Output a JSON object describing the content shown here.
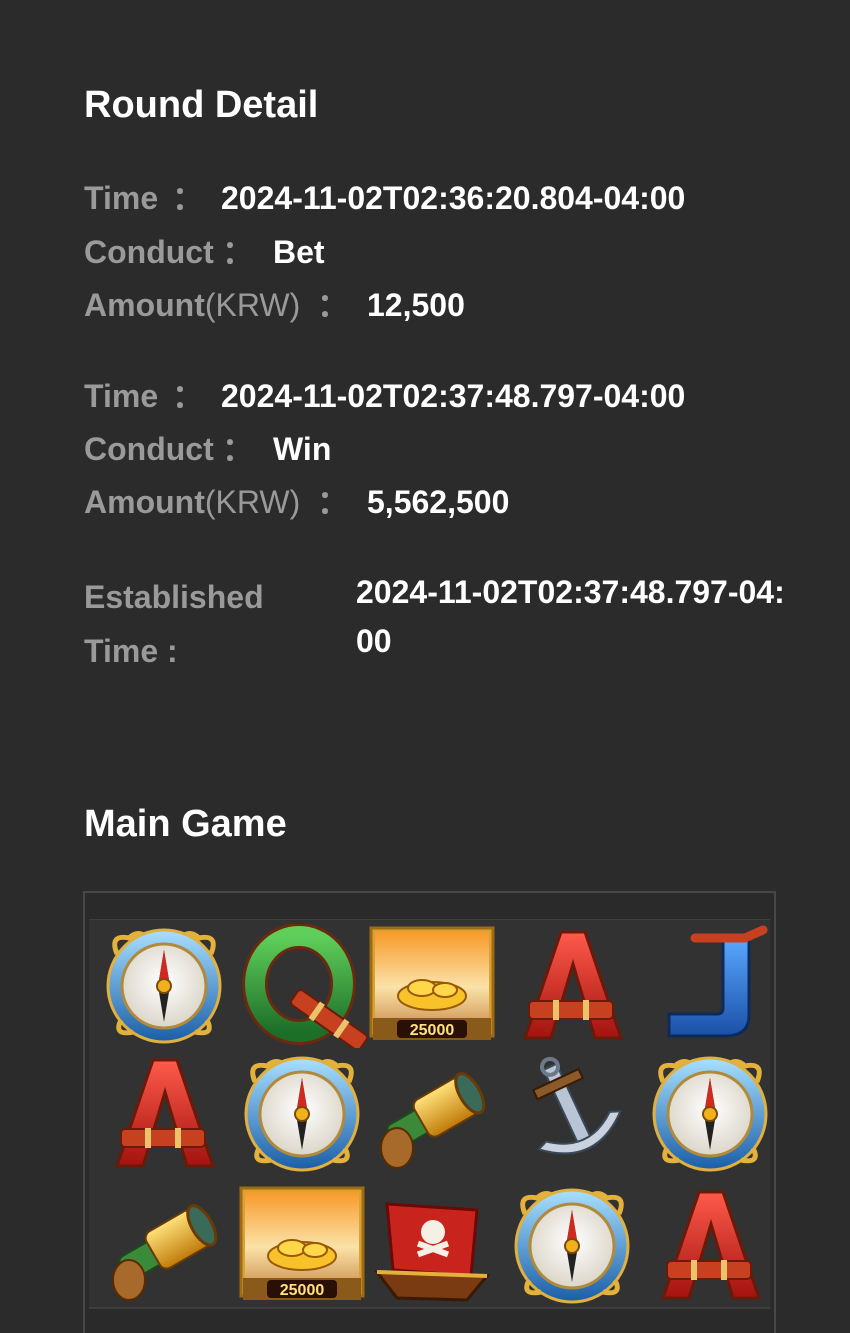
{
  "round_detail": {
    "title": "Round Detail",
    "colon": "：",
    "entries": [
      {
        "time_label": "Time",
        "time_value": "2024-11-02T02:36:20.804-04:00",
        "conduct_label": "Conduct",
        "conduct_value": "Bet",
        "amount_label": "Amount",
        "amount_unit": "(KRW)",
        "amount_value": "12,500"
      },
      {
        "time_label": "Time",
        "time_value": "2024-11-02T02:37:48.797-04:00",
        "conduct_label": "Conduct",
        "conduct_value": "Win",
        "amount_label": "Amount",
        "amount_unit": "(KRW)",
        "amount_value": "5,562,500"
      }
    ],
    "established_label": "Established Time :",
    "established_value": "2024-11-02T02:37:48.797-04:00"
  },
  "main_game": {
    "title": "Main Game",
    "reels": [
      [
        "compass",
        "Q",
        "gold-25000",
        "A",
        "J"
      ],
      [
        "A",
        "compass",
        "spyglass",
        "anchor",
        "compass"
      ],
      [
        "spyglass",
        "gold-25000",
        "pirate-ship",
        "compass",
        "A"
      ]
    ],
    "gold_label": "25000",
    "colors": {
      "background": "#2b2b2c",
      "label_gray": "#9a9a9a",
      "value_white": "#ffffff",
      "letter_red": "#d42a24",
      "letter_green": "#2f9a3a",
      "letter_blue": "#2f6fd0",
      "gold": "#f2b01c"
    }
  }
}
